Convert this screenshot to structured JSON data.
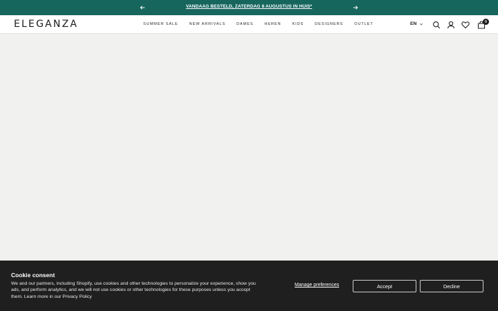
{
  "announcement": {
    "message": "VANDAAG BESTELD, ZATERDAG 8 AUGUSTUS IN HUIS*",
    "prev_icon": "arrow-left-icon",
    "next_icon": "arrow-right-icon"
  },
  "header": {
    "logo": "ELEGANZA",
    "nav": [
      "SUMMER SALE",
      "NEW ARRIVALS",
      "DAMES",
      "HEREN",
      "KIDS",
      "DESIGNERS",
      "OUTLET"
    ],
    "language": "EN",
    "cart_count": "0",
    "icons": [
      "search-icon",
      "account-icon",
      "heart-icon",
      "cart-icon"
    ]
  },
  "cookie": {
    "title": "Cookie consent",
    "text": "We and our partners, including Shopify, use cookies and other technologies to personalize your experience, show you ads, and perform analytics, and we will not use cookies or other technologies for these purposes unless you accept them. Learn more in our Privacy Policy",
    "manage_label": "Manage preferences",
    "accept_label": "Accept",
    "decline_label": "Decline"
  },
  "colors": {
    "announcement_bg": "#16665e",
    "page_bg": "#f1f1f0",
    "cookie_bg": "#1f1f1f"
  }
}
